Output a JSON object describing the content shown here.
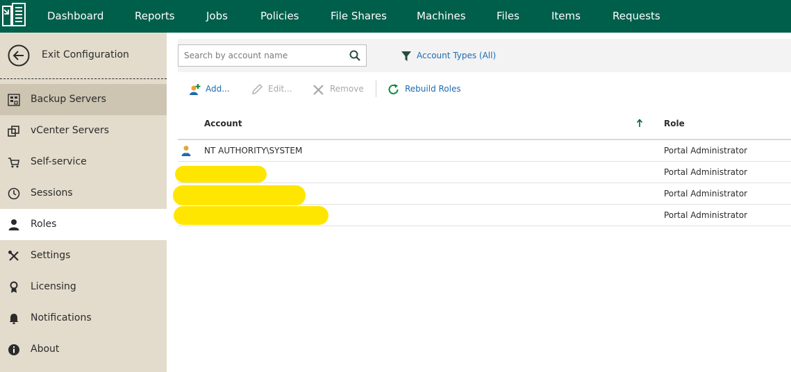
{
  "nav": {
    "items": [
      "Dashboard",
      "Reports",
      "Jobs",
      "Policies",
      "File Shares",
      "Machines",
      "Files",
      "Items",
      "Requests"
    ]
  },
  "sidebar": {
    "exit_label": "Exit Configuration",
    "items": [
      {
        "label": "Backup Servers",
        "icon": "backup-servers-icon"
      },
      {
        "label": "vCenter Servers",
        "icon": "vcenter-servers-icon"
      },
      {
        "label": "Self-service",
        "icon": "cart-icon"
      },
      {
        "label": "Sessions",
        "icon": "clock-icon"
      },
      {
        "label": "Roles",
        "icon": "user-icon"
      },
      {
        "label": "Settings",
        "icon": "tools-icon"
      },
      {
        "label": "Licensing",
        "icon": "license-icon"
      },
      {
        "label": "Notifications",
        "icon": "bell-icon"
      },
      {
        "label": "About",
        "icon": "info-icon"
      }
    ]
  },
  "filter": {
    "search_placeholder": "Search by account name",
    "account_types_label": "Account Types (All)"
  },
  "toolbar": {
    "add_label": "Add...",
    "edit_label": "Edit...",
    "remove_label": "Remove",
    "rebuild_label": "Rebuild Roles"
  },
  "table": {
    "columns": {
      "account": "Account",
      "role": "Role"
    },
    "rows": [
      {
        "account": "NT AUTHORITY\\SYSTEM",
        "role": "Portal Administrator"
      },
      {
        "account": "",
        "role": "Portal Administrator"
      },
      {
        "account": "",
        "role": "Portal Administrator"
      },
      {
        "account": "",
        "role": "Portal Administrator"
      }
    ]
  },
  "colors": {
    "topbar": "#005f4b",
    "sidebar": "#e3dccc",
    "sidebar_selected": "#cdc4b2",
    "link": "#1a6bb3",
    "accent_green": "#0a8a3a",
    "redaction": "#ffe600"
  }
}
